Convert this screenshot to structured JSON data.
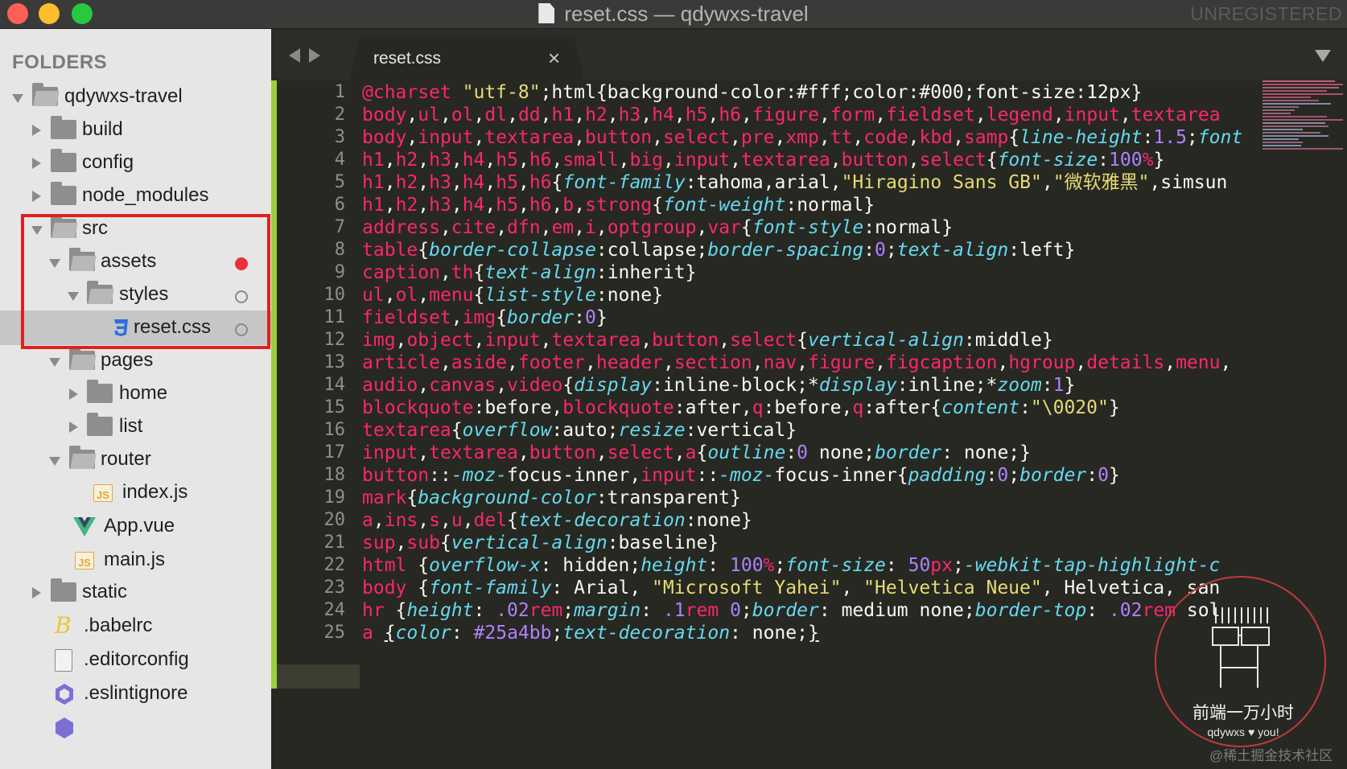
{
  "window": {
    "title": "reset.css — qdywxs-travel",
    "registration": "UNREGISTERED"
  },
  "sidebar": {
    "header": "FOLDERS",
    "items": [
      {
        "label": "qdywxs-travel"
      },
      {
        "label": "build"
      },
      {
        "label": "config"
      },
      {
        "label": "node_modules"
      },
      {
        "label": "src"
      },
      {
        "label": "assets"
      },
      {
        "label": "styles"
      },
      {
        "label": "reset.css"
      },
      {
        "label": "pages"
      },
      {
        "label": "home"
      },
      {
        "label": "list"
      },
      {
        "label": "router"
      },
      {
        "label": "index.js"
      },
      {
        "label": "App.vue"
      },
      {
        "label": "main.js"
      },
      {
        "label": "static"
      },
      {
        "label": ".babelrc"
      },
      {
        "label": ".editorconfig"
      },
      {
        "label": ".eslintignore"
      }
    ]
  },
  "tabs": [
    {
      "label": "reset.css",
      "close": "×"
    }
  ],
  "editor": {
    "current_line": 25,
    "line_numbers": [
      "1",
      "2",
      "3",
      "4",
      "5",
      "6",
      "7",
      "8",
      "9",
      "10",
      "11",
      "12",
      "13",
      "14",
      "15",
      "16",
      "17",
      "18",
      "19",
      "20",
      "21",
      "22",
      "23",
      "24",
      "25"
    ]
  },
  "watermark": {
    "title": "前端一万小时",
    "subtitle": "qdywxs ♥ you!",
    "corner": "@稀土掘金技术社区"
  },
  "colors": {
    "keyword": "#f92672",
    "property": "#66d9ef",
    "number": "#ae81ff",
    "string": "#e6db74",
    "modified_dot": "#e8323a",
    "highlight_box": "#e02020",
    "git_gutter": "#9ad13a"
  },
  "icons": {
    "folder": "folder-icon",
    "css_file": "css3-icon",
    "js_file": "js-icon",
    "vue_file": "vue-icon",
    "babel_file": "babel-icon",
    "generic_file": "file-icon",
    "eslint_file": "eslint-icon"
  }
}
